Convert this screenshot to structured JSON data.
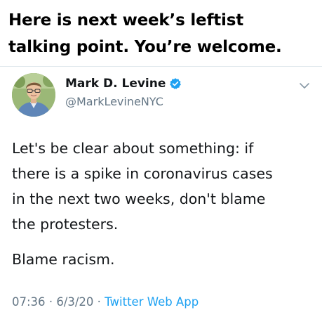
{
  "caption": {
    "line1": "Here is next week’s leftist",
    "line2": "talking point. You’re welcome."
  },
  "tweet": {
    "author_name": "Mark D. Levine",
    "handle": "@MarkLevineNYC",
    "verified": true,
    "verified_icon": "verified-badge-icon",
    "menu_icon": "chevron-down-icon",
    "text_lines": [
      "Let's be clear about something: if",
      "there is a spike in coronavirus cases",
      "in the next two weeks, don't blame",
      "the protesters."
    ],
    "text_second_paragraph": "Blame racism.",
    "time": "07:36",
    "separator": "·",
    "date": "6/3/20",
    "source": "Twitter Web App"
  },
  "colors": {
    "text_primary": "#14171a",
    "text_secondary": "#657786",
    "accent": "#1da1f2",
    "divider": "#e1e8ed"
  }
}
